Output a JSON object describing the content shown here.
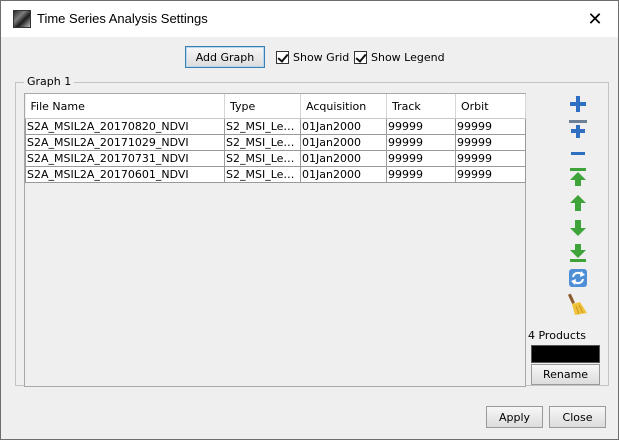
{
  "window": {
    "title": "Time Series Analysis Settings",
    "close_symbol": "✕",
    "icon": "app-logo-icon"
  },
  "toolbar": {
    "add_graph_label": "Add Graph",
    "show_grid_label": "Show Grid",
    "show_grid_checked": true,
    "show_legend_label": "Show Legend",
    "show_legend_checked": true
  },
  "graph": {
    "label": "Graph 1",
    "columns": [
      "File Name",
      "Type",
      "Acquisition",
      "Track",
      "Orbit"
    ],
    "rows": [
      [
        "S2A_MSIL2A_20170820_NDVI",
        "S2_MSI_Lev...",
        "01Jan2000",
        "99999",
        "99999"
      ],
      [
        "S2A_MSIL2A_20171029_NDVI",
        "S2_MSI_Lev...",
        "01Jan2000",
        "99999",
        "99999"
      ],
      [
        "S2A_MSIL2A_20170731_NDVI",
        "S2_MSI_Lev...",
        "01Jan2000",
        "99999",
        "99999"
      ],
      [
        "S2A_MSIL2A_20170601_NDVI",
        "S2_MSI_Lev...",
        "01Jan2000",
        "99999",
        "99999"
      ]
    ]
  },
  "side_tools": [
    "add-icon",
    "add-to-group-icon",
    "remove-icon",
    "move-top-icon",
    "move-up-icon",
    "move-down-icon",
    "move-bottom-icon",
    "refresh-icon",
    "clear-broom-icon"
  ],
  "side_panel": {
    "products_count": "4 Products",
    "rename_label": "Rename"
  },
  "footer": {
    "apply_label": "Apply",
    "close_label": "Close"
  },
  "colors": {
    "accent_blue": "#2f6fc2",
    "arrow_green": "#3ea43a",
    "focus_border": "#3c7fb1"
  }
}
